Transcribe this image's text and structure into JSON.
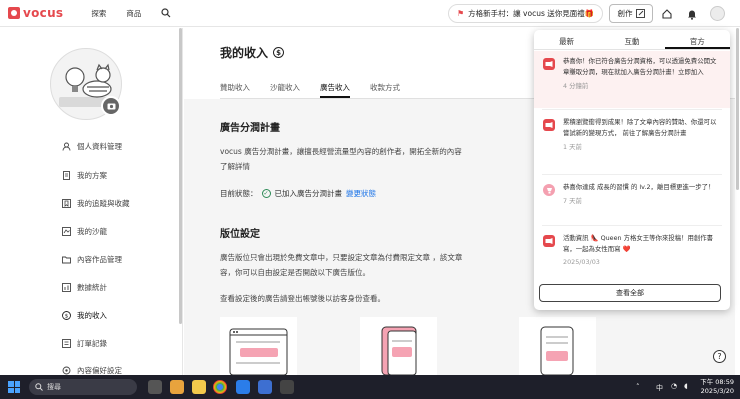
{
  "nav": {
    "logo": "vocus",
    "links": [
      "探索",
      "商品"
    ],
    "promo": "方格新手村：讓 vocus 送你見面禮🎁",
    "create_label": "創作"
  },
  "sidebar": {
    "items": [
      {
        "label": "個人資料管理",
        "icon": "person-icon"
      },
      {
        "label": "我的方案",
        "icon": "document-icon"
      },
      {
        "label": "我的追蹤與收藏",
        "icon": "bookmark-icon"
      },
      {
        "label": "我的沙龍",
        "icon": "salon-icon"
      },
      {
        "label": "內容作品管理",
        "icon": "folder-icon"
      },
      {
        "label": "數據統計",
        "icon": "chart-icon"
      },
      {
        "label": "我的收入",
        "icon": "dollar-icon"
      },
      {
        "label": "訂單記錄",
        "icon": "receipt-icon"
      },
      {
        "label": "內容偏好設定",
        "icon": "settings-icon"
      }
    ]
  },
  "main": {
    "title": "我的收入",
    "tabs": [
      "贊助收入",
      "沙龍收入",
      "廣告收入",
      "收款方式"
    ],
    "active_tab": 2,
    "ad_section": {
      "title": "廣告分潤計畫",
      "para_line1": "vocus 廣告分潤計畫，讓擅長經營流量型內容的創作者，開拓全新的內容",
      "para_line2": "了解詳情",
      "status_label": "目前狀態：",
      "status_value": "已加入廣告分潤計畫",
      "status_link": "變更狀態"
    },
    "slot_section": {
      "title": "版位設定",
      "para_line1": "廣告版位只會出現於免費文章中，只要設定文章為付費限定文章 ，該文章",
      "para_line2": "容，你可以自由設定是否開啟以下廣告版位。",
      "para_line3": "查看設定後的廣告請登出帳號後以訪客身份查看。"
    }
  },
  "notifications": {
    "tabs": [
      "最新",
      "互動",
      "官方"
    ],
    "active_tab": 2,
    "items": [
      {
        "text": "恭喜你！你已符合廣告分潤資格，可以透過免費公開文章賺取分潤，現在就加入廣告分潤計畫！立即加入",
        "time": "4 分鐘前",
        "unread": true
      },
      {
        "text": "累積瀏覽衝得到成果！除了文章內容的贊助、你還可以嘗試新的變現方式， 前往了解廣告分潤計畫",
        "time": "1 天前",
        "unread": false
      },
      {
        "text": "恭喜你達成 成長的習慣 的 lv.2，離目標更進一步了！",
        "time": "7 天前",
        "unread": false
      },
      {
        "text": "活動資訊 👠 Queen 方格女王等你來投稿！用創作書寫，一起為女性而寫 ❤️",
        "time": "2025/03/03",
        "unread": false
      }
    ],
    "view_all": "查看全部"
  },
  "taskbar": {
    "search_placeholder": "搜尋",
    "lang": "中",
    "time": "下午 08:59",
    "date": "2025/3/20"
  },
  "colors": {
    "brand": "#e5484d",
    "link": "#1a73e8"
  }
}
